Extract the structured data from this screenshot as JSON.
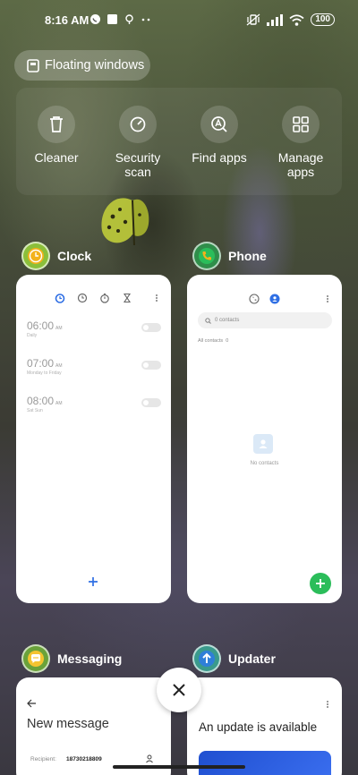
{
  "status_bar": {
    "time": "8:16 AM",
    "icons_left": [
      "whatsapp-icon",
      "stop-icon",
      "location-icon",
      "more-dots-icon"
    ],
    "icons_right": [
      "mute-vibrate-icon",
      "signal-icon",
      "wifi-icon"
    ],
    "battery": "100"
  },
  "floating_windows": {
    "label": "Floating windows"
  },
  "quick_actions": [
    {
      "label": "Cleaner",
      "icon": "trash-icon"
    },
    {
      "label": "Security\nscan",
      "icon": "security-scan-icon"
    },
    {
      "label": "Find apps",
      "icon": "find-apps-icon"
    },
    {
      "label": "Manage\napps",
      "icon": "grid-icon"
    }
  ],
  "apps": {
    "clock": {
      "name": "Clock",
      "alarms": [
        {
          "time": "06:00",
          "ampm": "AM",
          "sub": "Daily"
        },
        {
          "time": "07:00",
          "ampm": "AM",
          "sub": "Monday to Friday"
        },
        {
          "time": "08:00",
          "ampm": "AM",
          "sub": "Sat Sun"
        }
      ]
    },
    "phone": {
      "name": "Phone",
      "search_placeholder": "0 contacts",
      "all_contacts": "All contacts",
      "contacts_count": "0",
      "empty_text": "No contacts"
    },
    "messaging": {
      "name": "Messaging",
      "title": "New message",
      "recipient_label": "Recipient:",
      "recipient_value": "18730218809"
    },
    "updater": {
      "name": "Updater",
      "title": "An update is available"
    }
  },
  "colors": {
    "phone_green": "#2bbd5a",
    "clock_yellow": "#f3b21a",
    "messaging_yellow": "#f4c430",
    "updater_blue": "#2f7fd8",
    "accent_blue": "#2f6fe4"
  }
}
